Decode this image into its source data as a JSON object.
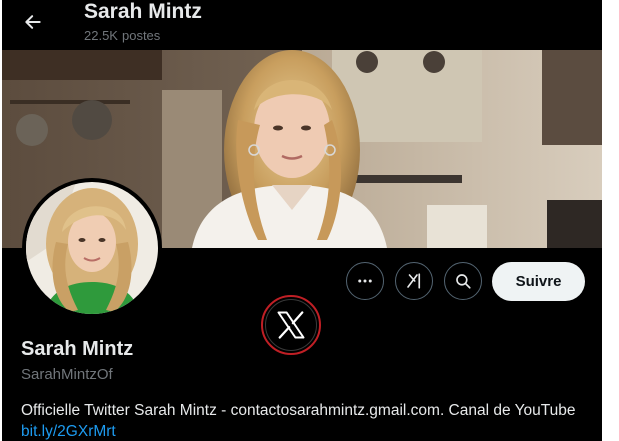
{
  "header": {
    "name": "Sarah Mintz",
    "post_count": "22.5K",
    "post_label": "postes",
    "back_icon": "arrow-left-icon"
  },
  "profile": {
    "name": "Sarah Mintz",
    "handle": "SarahMintzOf",
    "bio_text": "Officielle Twitter Sarah Mintz - contactosarahmintz.gmail.com. Canal de YouTube",
    "bio_link": "bit.ly/2GXrMrt"
  },
  "actions": {
    "more_icon": "more-horizontal-icon",
    "grok_icon": "grok-icon",
    "search_icon": "search-icon",
    "follow_label": "Suivre"
  },
  "overlay": {
    "logo_icon": "x-logo-icon"
  },
  "colors": {
    "background": "#000000",
    "primary_text": "#e7e9ea",
    "secondary_text": "#71767b",
    "link": "#1d9bf0",
    "follow_button": "#eff3f4",
    "logo_ring": "#c01f25"
  }
}
